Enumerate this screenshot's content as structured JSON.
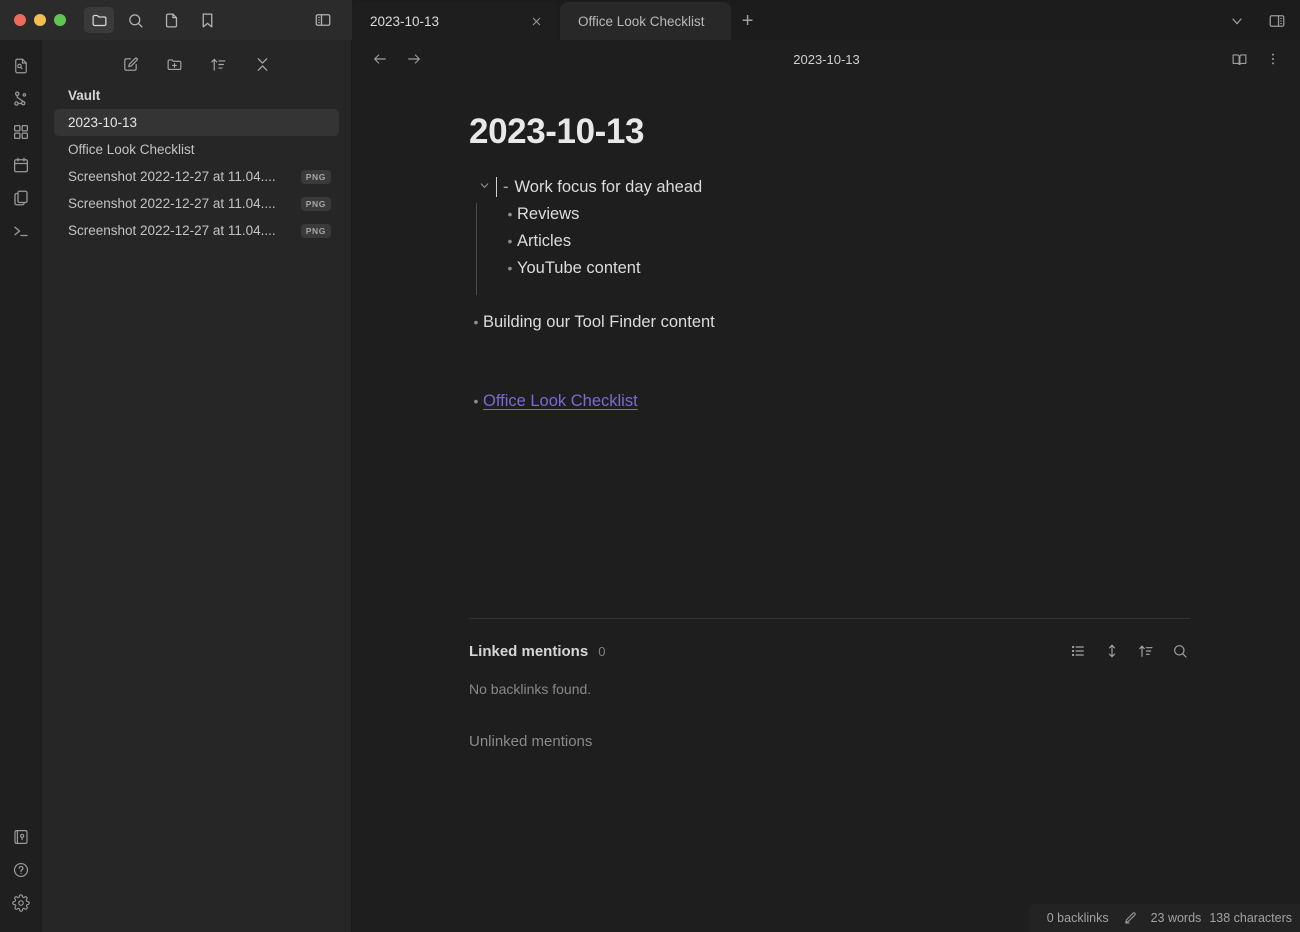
{
  "window": {
    "traffic_lights": [
      "close",
      "minimize",
      "zoom"
    ],
    "titlebar_buttons": [
      {
        "name": "folder-icon",
        "label": "Files",
        "active": true
      },
      {
        "name": "search-icon",
        "label": "Search",
        "active": false
      },
      {
        "name": "file-icon",
        "label": "Quick switcher",
        "active": false
      },
      {
        "name": "bookmark-icon",
        "label": "Bookmarks",
        "active": false
      }
    ],
    "left_sidebar_toggle": "sidebar-left-icon",
    "right_sidebar_toggle": "sidebar-right-icon",
    "tab_overflow": "chevron-down-icon"
  },
  "tabs": [
    {
      "title": "2023-10-13",
      "active": true,
      "close_label": "✕"
    },
    {
      "title": "Office Look Checklist",
      "active": false
    }
  ],
  "tab_add_label": "+",
  "ribbon": {
    "top": [
      {
        "name": "quick-switcher-icon",
        "label": "Open quick switcher"
      },
      {
        "name": "graph-view-icon",
        "label": "Open graph view"
      },
      {
        "name": "canvas-icon",
        "label": "Create new canvas"
      },
      {
        "name": "calendar-icon",
        "label": "Open daily note"
      },
      {
        "name": "templates-icon",
        "label": "Insert template"
      },
      {
        "name": "terminal-icon",
        "label": "Open terminal"
      }
    ],
    "bottom": [
      {
        "name": "vault-switcher-icon",
        "label": "Open another vault"
      },
      {
        "name": "help-icon",
        "label": "Help"
      },
      {
        "name": "settings-icon",
        "label": "Settings"
      }
    ]
  },
  "explorer": {
    "toolbar": [
      {
        "name": "new-note-icon",
        "label": "New note"
      },
      {
        "name": "new-folder-icon",
        "label": "New folder"
      },
      {
        "name": "sort-icon",
        "label": "Change sort order"
      },
      {
        "name": "collapse-all-icon",
        "label": "Collapse all"
      }
    ],
    "vault_name": "Vault",
    "files": [
      {
        "name": "2023-10-13",
        "tag": "",
        "selected": true
      },
      {
        "name": "Office Look Checklist",
        "tag": "",
        "selected": false
      },
      {
        "name": "Screenshot 2022-12-27 at 11.04....",
        "tag": "PNG",
        "selected": false
      },
      {
        "name": "Screenshot 2022-12-27 at 11.04....",
        "tag": "PNG",
        "selected": false
      },
      {
        "name": "Screenshot 2022-12-27 at 11.04....",
        "tag": "PNG",
        "selected": false
      }
    ]
  },
  "view_header": {
    "back_label": "Back",
    "forward_label": "Forward",
    "title": "2023-10-13",
    "reading_view_label": "Reading view",
    "more_options_label": "More options"
  },
  "note": {
    "title": "2023-10-13",
    "items": [
      {
        "text": "Work focus for day ahead",
        "source_marker": "-",
        "has_fold": true,
        "children": [
          "Reviews",
          "Articles",
          "YouTube content"
        ]
      },
      {
        "text": "Building our Tool Finder content",
        "has_fold": false,
        "children": []
      },
      {
        "text": "Office Look Checklist",
        "is_link": true,
        "has_fold": false,
        "children": []
      }
    ]
  },
  "backlinks": {
    "title": "Linked mentions",
    "count": "0",
    "empty_text": "No backlinks found.",
    "unlinked_title": "Unlinked mentions",
    "tools": [
      {
        "name": "collapse-results-icon",
        "label": "Collapse results"
      },
      {
        "name": "show-more-context-icon",
        "label": "Show more context"
      },
      {
        "name": "sort-order-icon",
        "label": "Change sort order"
      },
      {
        "name": "search-filter-icon",
        "label": "Filter backlinks"
      }
    ]
  },
  "statusbar": {
    "backlinks": "0 backlinks",
    "edit_icon": "pencil-icon",
    "words": "23 words",
    "characters": "138 characters"
  },
  "colors": {
    "accent_link": "#7a6ad3",
    "bg_primary": "#1e1e1e",
    "bg_sidebar": "#262626",
    "bg_titlebar": "#1c1c1c",
    "selection": "#343434"
  }
}
